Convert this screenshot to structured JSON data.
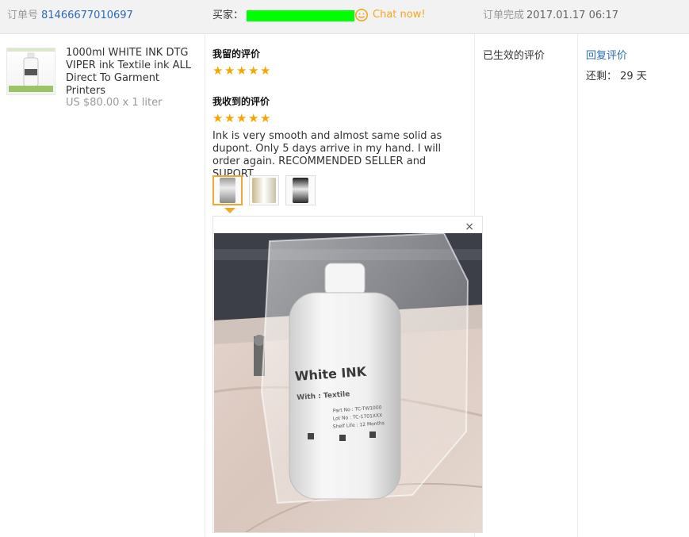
{
  "header": {
    "order_label": "订单号",
    "order_number": "81466677010697",
    "buyer_label": "买家：",
    "chat_label": "Chat now!",
    "status_label": "订单完成",
    "timestamp": "2017.01.17 06:17"
  },
  "product": {
    "title": "1000ml WHITE INK DTG VIPER ink Textile ink ALL Direct To Garment Printers",
    "price": "US $80.00 x 1 liter"
  },
  "review": {
    "my_review_label": "我留的评价",
    "my_stars": 5,
    "received_review_label": "我收到的评价",
    "received_stars": 5,
    "text": "Ink is very smooth and almost same solid as dupont. Only 5 days arrive in my hand. I will order again. RECOMMENDED SELLER and SUPORT.",
    "close_symbol": "×"
  },
  "status": {
    "effective_label": "已生效的评价"
  },
  "action": {
    "reply_label": "回复评价",
    "remaining_label": "还剩：",
    "remaining_value": "29 天"
  },
  "photo": {
    "bottle_label_main": "White INK",
    "bottle_label_sub": "With : Textile",
    "bottle_part_no": "Part No : TC-TW1000",
    "bottle_lot_no": "Lot  No : TC-1701XXX",
    "bottle_shelf": "Shelf Life : 12 Months"
  },
  "colors": {
    "accent_link": "#2a6bb7",
    "chat_orange": "#f5a623",
    "star": "#f7a600",
    "buyer_redaction": "#00ff00"
  }
}
